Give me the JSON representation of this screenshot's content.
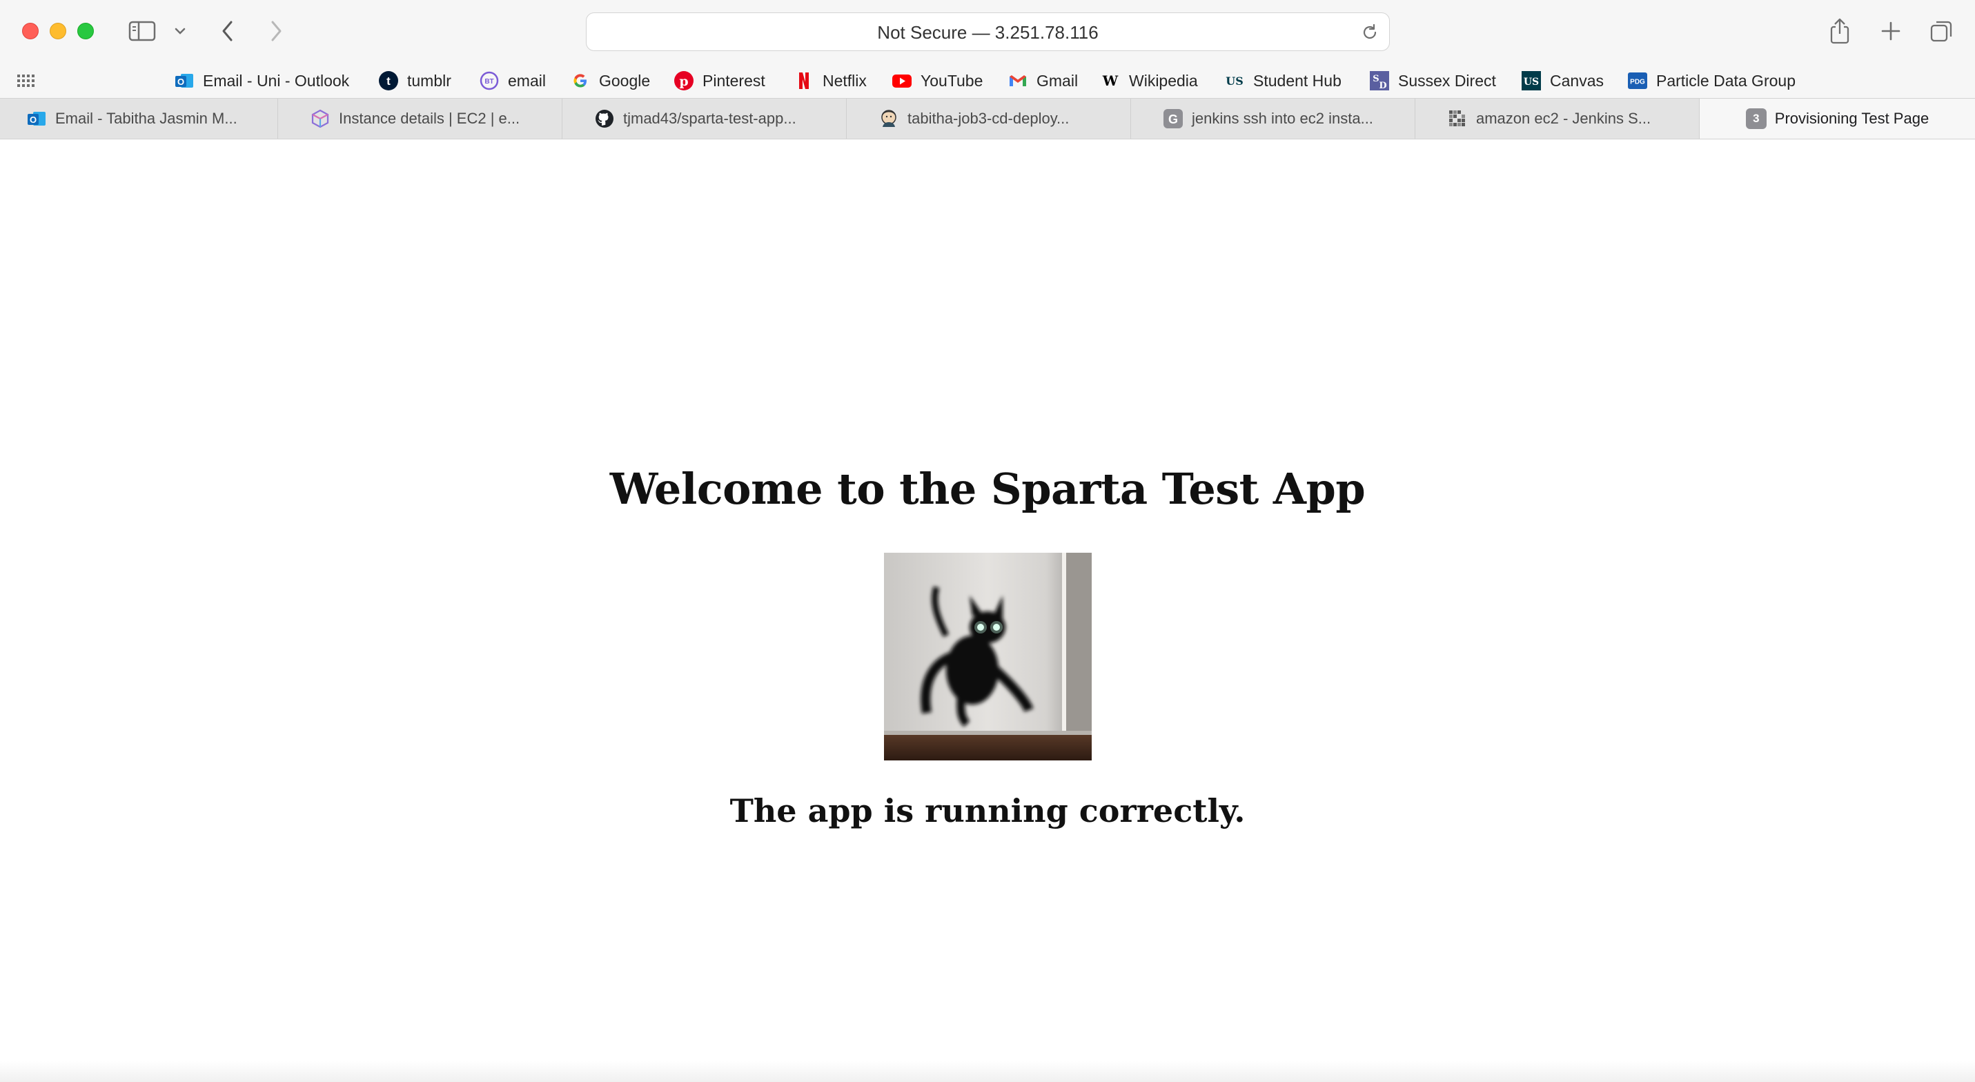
{
  "window": {
    "address_bar": {
      "text": "Not Secure — 3.251.78.116"
    }
  },
  "favorites": [
    {
      "label": "Email - Uni - Outlook",
      "icon": "outlook-icon",
      "color": "#0f6cbd"
    },
    {
      "label": "tumblr",
      "icon": "tumblr-icon",
      "color": "#001935"
    },
    {
      "label": "email",
      "icon": "email-icon",
      "color": "#7b5bd6"
    },
    {
      "label": "Google",
      "icon": "google-icon",
      "color": "#4285f4"
    },
    {
      "label": "Pinterest",
      "icon": "pinterest-icon",
      "color": "#e60023"
    },
    {
      "label": "Netflix",
      "icon": "netflix-icon",
      "color": "#e50914"
    },
    {
      "label": "YouTube",
      "icon": "youtube-icon",
      "color": "#ff0000"
    },
    {
      "label": "Gmail",
      "icon": "gmail-icon",
      "color": "#ea4335"
    },
    {
      "label": "Wikipedia",
      "icon": "wikipedia-icon",
      "color": "#000000"
    },
    {
      "label": "Student Hub",
      "icon": "us-logo-icon",
      "color": "#003b49"
    },
    {
      "label": "Sussex Direct",
      "icon": "sussex-direct-icon",
      "color": "#5a5fa0"
    },
    {
      "label": "Canvas",
      "icon": "us-canvas-icon",
      "color": "#003b49"
    },
    {
      "label": "Particle Data Group",
      "icon": "pdg-icon",
      "color": "#1a5fb4"
    }
  ],
  "tabs": [
    {
      "label": "Email - Tabitha Jasmin M...",
      "icon": "outlook-icon",
      "active": false
    },
    {
      "label": "Instance details | EC2 | e...",
      "icon": "aws-cube-icon",
      "active": false
    },
    {
      "label": "tjmad43/sparta-test-app...",
      "icon": "github-icon",
      "active": false
    },
    {
      "label": "tabitha-job3-cd-deploy...",
      "icon": "jenkins-icon",
      "active": false
    },
    {
      "label": "jenkins ssh into ec2 insta...",
      "icon": "google-g-icon",
      "active": false
    },
    {
      "label": "amazon ec2 - Jenkins S...",
      "icon": "stackoverflow-icon",
      "active": false
    },
    {
      "label": "Provisioning Test Page",
      "icon": "number-badge-icon",
      "badge": "3",
      "active": true
    }
  ],
  "page": {
    "heading": "Welcome to the Sparta Test App",
    "image_alt": "cat-photo",
    "status": "The app is running correctly."
  }
}
